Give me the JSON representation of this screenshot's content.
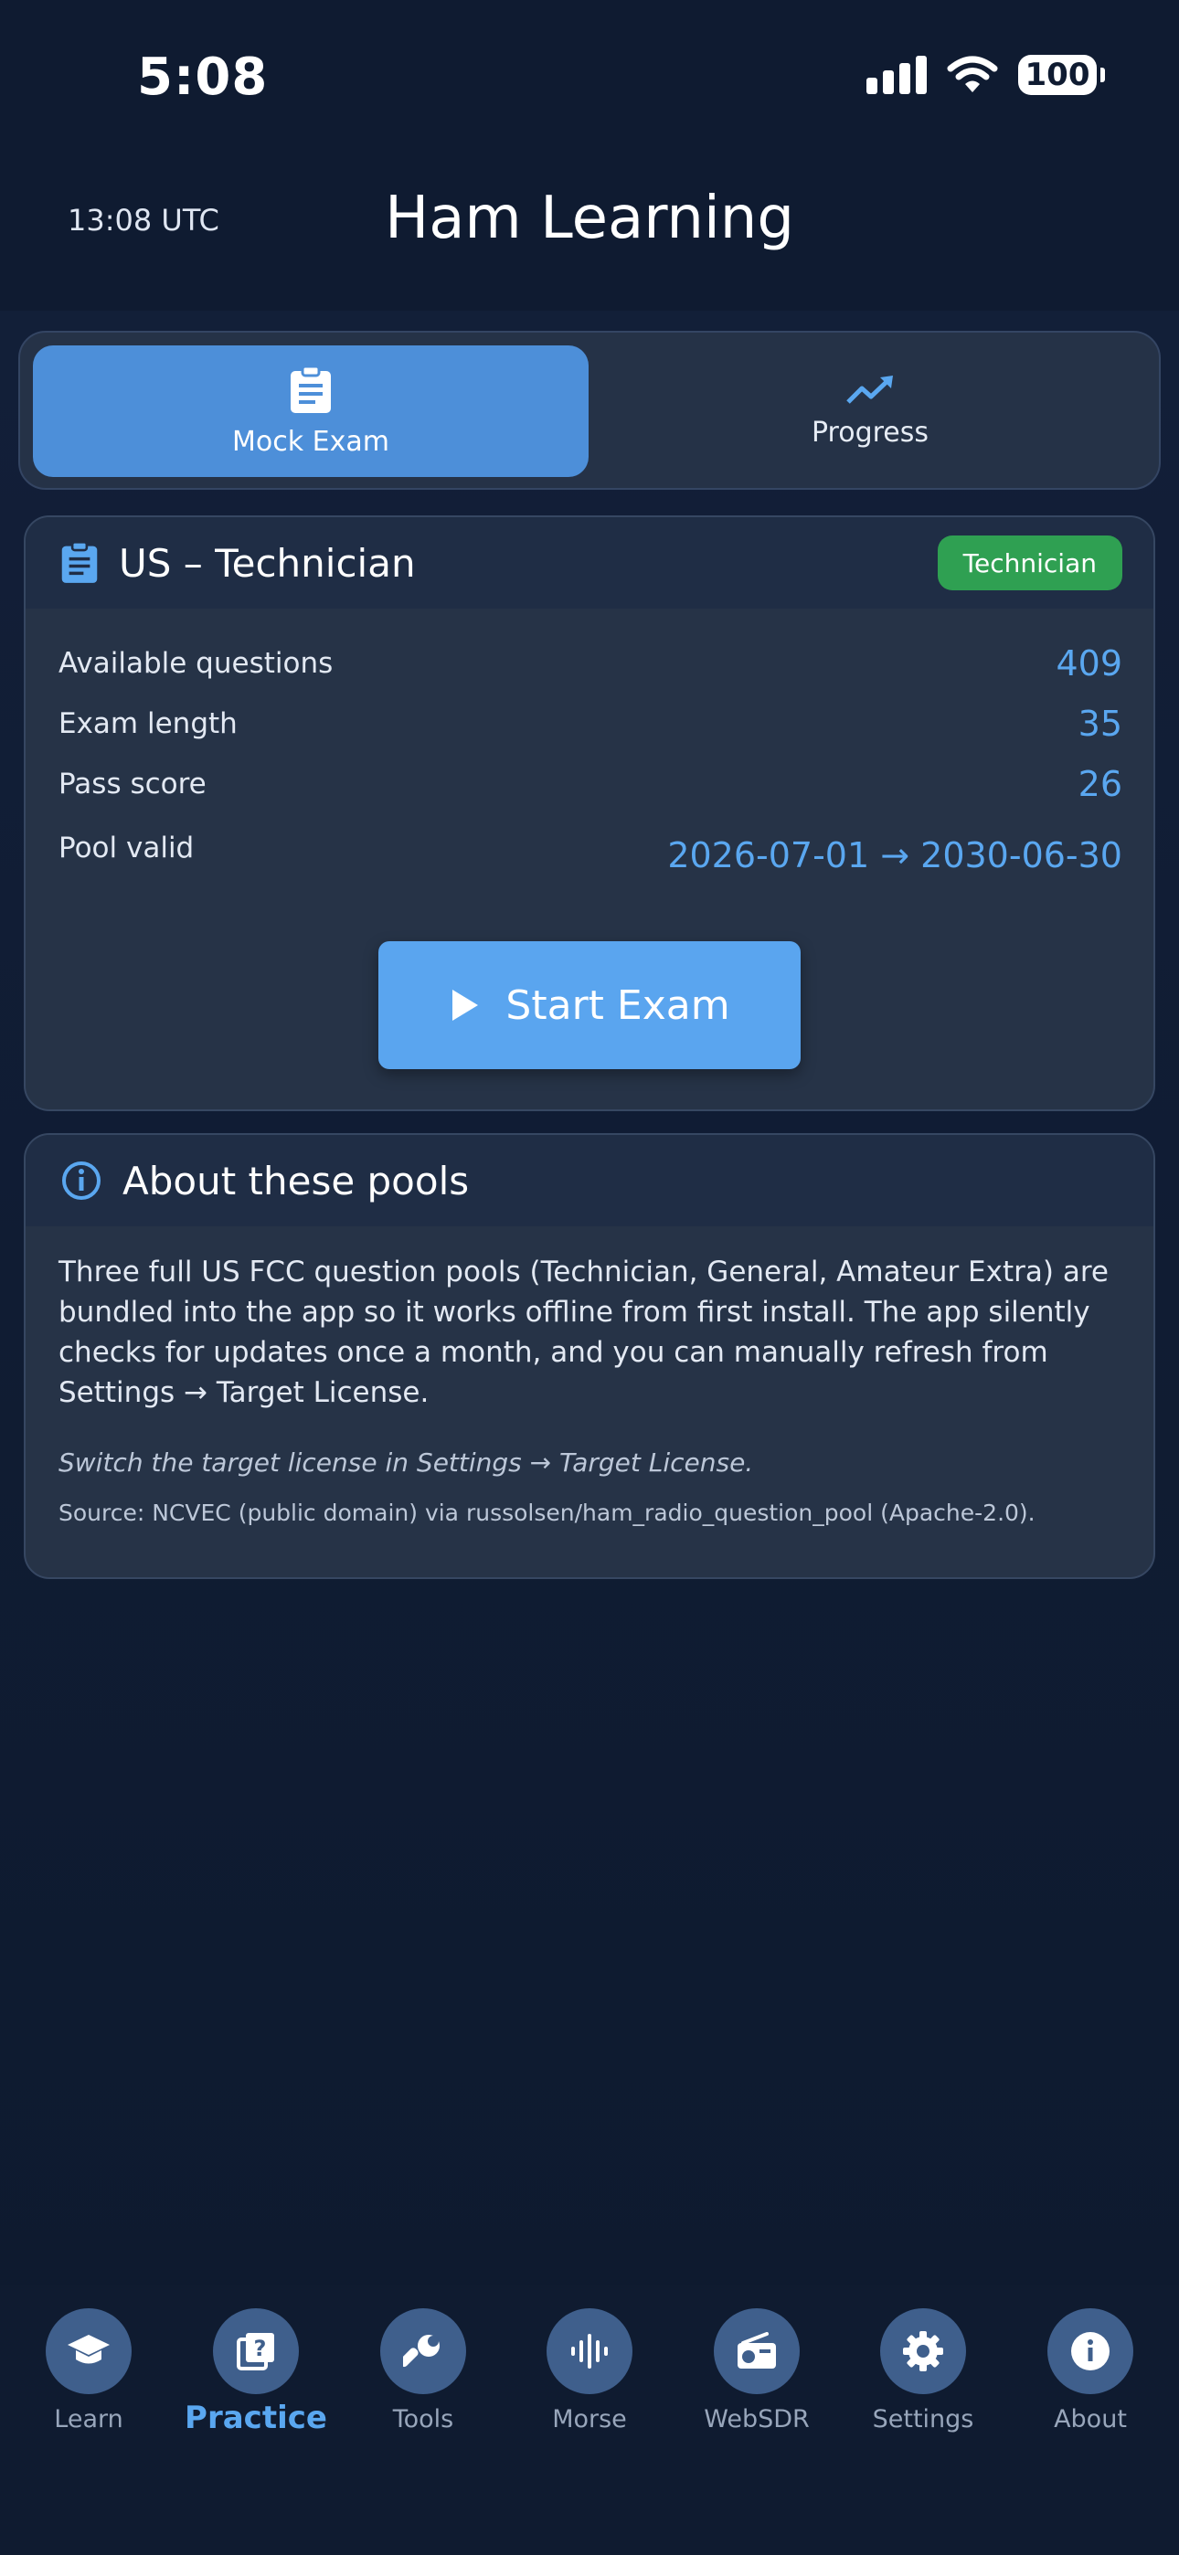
{
  "status": {
    "time": "5:08",
    "battery": "100"
  },
  "header": {
    "utc": "13:08 UTC",
    "title": "Ham Learning"
  },
  "segments": [
    {
      "label": "Mock Exam",
      "icon": "clipboard-icon",
      "active": true
    },
    {
      "label": "Progress",
      "icon": "trending-up-icon",
      "active": false
    }
  ],
  "exam": {
    "title": "US – Technician",
    "badge": "Technician",
    "rows": [
      {
        "label": "Available questions",
        "value": "409"
      },
      {
        "label": "Exam length",
        "value": "35"
      },
      {
        "label": "Pass score",
        "value": "26"
      },
      {
        "label": "Pool valid",
        "value": "2026-07-01 → 2030-06-30"
      }
    ],
    "start_label": "Start Exam"
  },
  "about": {
    "title": "About these pools",
    "text": "Three full US FCC question pools (Technician, General, Amateur Extra) are bundled into the app so it works offline from first install. The app silently checks for updates once a month, and you can manually refresh from Settings → Target License.",
    "note": "Switch the target license in Settings → Target License.",
    "source": "Source: NCVEC (public domain) via russolsen/ham_radio_question_pool (Apache-2.0)."
  },
  "tabs": [
    {
      "label": "Learn",
      "icon": "graduation-cap-icon"
    },
    {
      "label": "Practice",
      "icon": "quiz-icon",
      "active": true
    },
    {
      "label": "Tools",
      "icon": "wrench-icon"
    },
    {
      "label": "Morse",
      "icon": "waveform-icon"
    },
    {
      "label": "WebSDR",
      "icon": "radio-icon"
    },
    {
      "label": "Settings",
      "icon": "gear-icon"
    },
    {
      "label": "About",
      "icon": "info-icon"
    }
  ],
  "colors": {
    "accent": "#5aa7f0",
    "badge": "#2fa052",
    "active_segment": "#4d8fd9"
  }
}
